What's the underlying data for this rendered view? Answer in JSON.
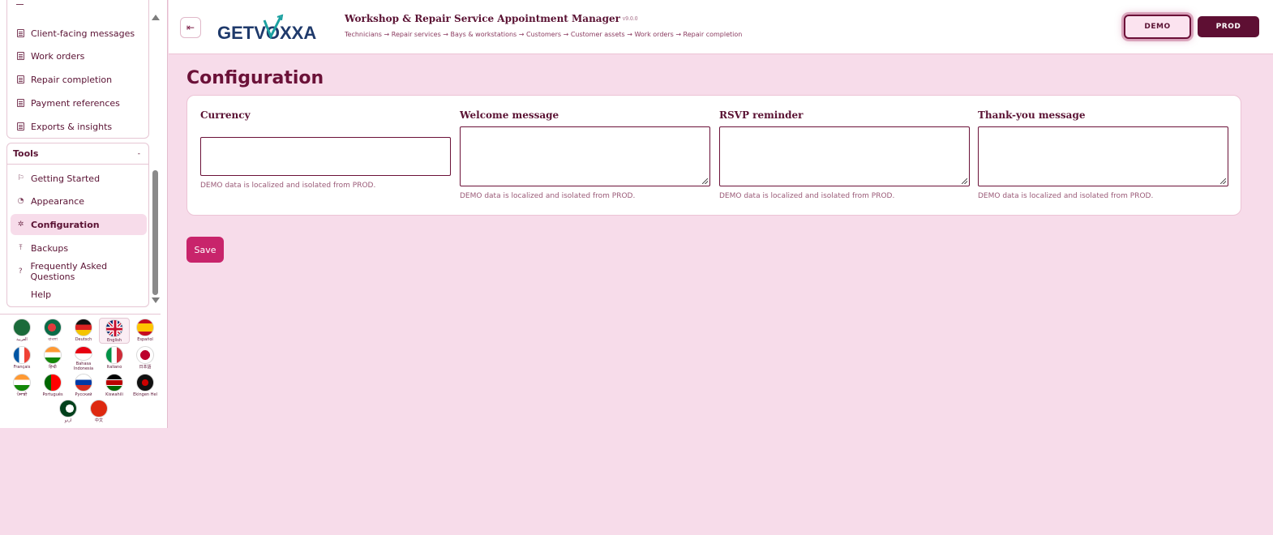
{
  "header": {
    "logo_text": "GETVOXXA",
    "app_title": "Workshop & Repair Service Appointment Manager",
    "app_version": "v9.0.0",
    "flow": "Technicians → Repair services → Bays & workstations → Customers → Customer assets → Work orders → Repair completion",
    "demo_label": "DEMO",
    "prod_label": "PROD",
    "collapse_icon": "sidebar-collapse-icon"
  },
  "sidebar": {
    "top_items": [
      {
        "label": "Client-facing messages",
        "icon": "document-icon"
      },
      {
        "label": "Work orders",
        "icon": "document-icon"
      },
      {
        "label": "Repair completion",
        "icon": "document-icon"
      },
      {
        "label": "Payment references",
        "icon": "document-icon"
      },
      {
        "label": "Exports & insights",
        "icon": "document-icon"
      }
    ],
    "tools": {
      "title": "Tools",
      "toggle": "-",
      "items": [
        {
          "label": "Getting Started",
          "icon": "flag-icon"
        },
        {
          "label": "Appearance",
          "icon": "palette-icon"
        },
        {
          "label": "Configuration",
          "icon": "gear-icon",
          "active": true
        },
        {
          "label": "Backups",
          "icon": "upload-icon"
        },
        {
          "label": "Frequently Asked Questions",
          "icon": "question-icon"
        },
        {
          "label": "Help",
          "icon": ""
        }
      ]
    },
    "languages": [
      {
        "name": "العربية",
        "flag": "sa"
      },
      {
        "name": "বাংলা",
        "flag": "bd"
      },
      {
        "name": "Deutsch",
        "flag": "de"
      },
      {
        "name": "English",
        "flag": "gb",
        "selected": true
      },
      {
        "name": "Español",
        "flag": "es"
      },
      {
        "name": "Français",
        "flag": "fr"
      },
      {
        "name": "हिन्दी",
        "flag": "in"
      },
      {
        "name": "Bahasa Indonesia",
        "flag": "id"
      },
      {
        "name": "Italiano",
        "flag": "it"
      },
      {
        "name": "日本語",
        "flag": "jp"
      },
      {
        "name": "ਪੰਜਾਬੀ",
        "flag": "in"
      },
      {
        "name": "Português",
        "flag": "pt"
      },
      {
        "name": "Русский",
        "flag": "ru"
      },
      {
        "name": "Kiswahili",
        "flag": "ke"
      },
      {
        "name": "Ekingen Hel",
        "flag": "other"
      },
      {
        "name": "اردو",
        "flag": "pk"
      },
      {
        "name": "中文",
        "flag": "cn"
      }
    ]
  },
  "main": {
    "title": "Configuration",
    "fields": [
      {
        "label": "Currency",
        "value": "",
        "hint": "DEMO data is localized and isolated from PROD."
      },
      {
        "label": "Welcome message",
        "value": "",
        "hint": "DEMO data is localized and isolated from PROD."
      },
      {
        "label": "RSVP reminder",
        "value": "",
        "hint": "DEMO data is localized and isolated from PROD."
      },
      {
        "label": "Thank-you message",
        "value": "",
        "hint": "DEMO data is localized and isolated from PROD."
      }
    ],
    "save_label": "Save"
  },
  "colors": {
    "brand": "#6b1138",
    "accent": "#c8246b",
    "background": "#f7dcea"
  }
}
